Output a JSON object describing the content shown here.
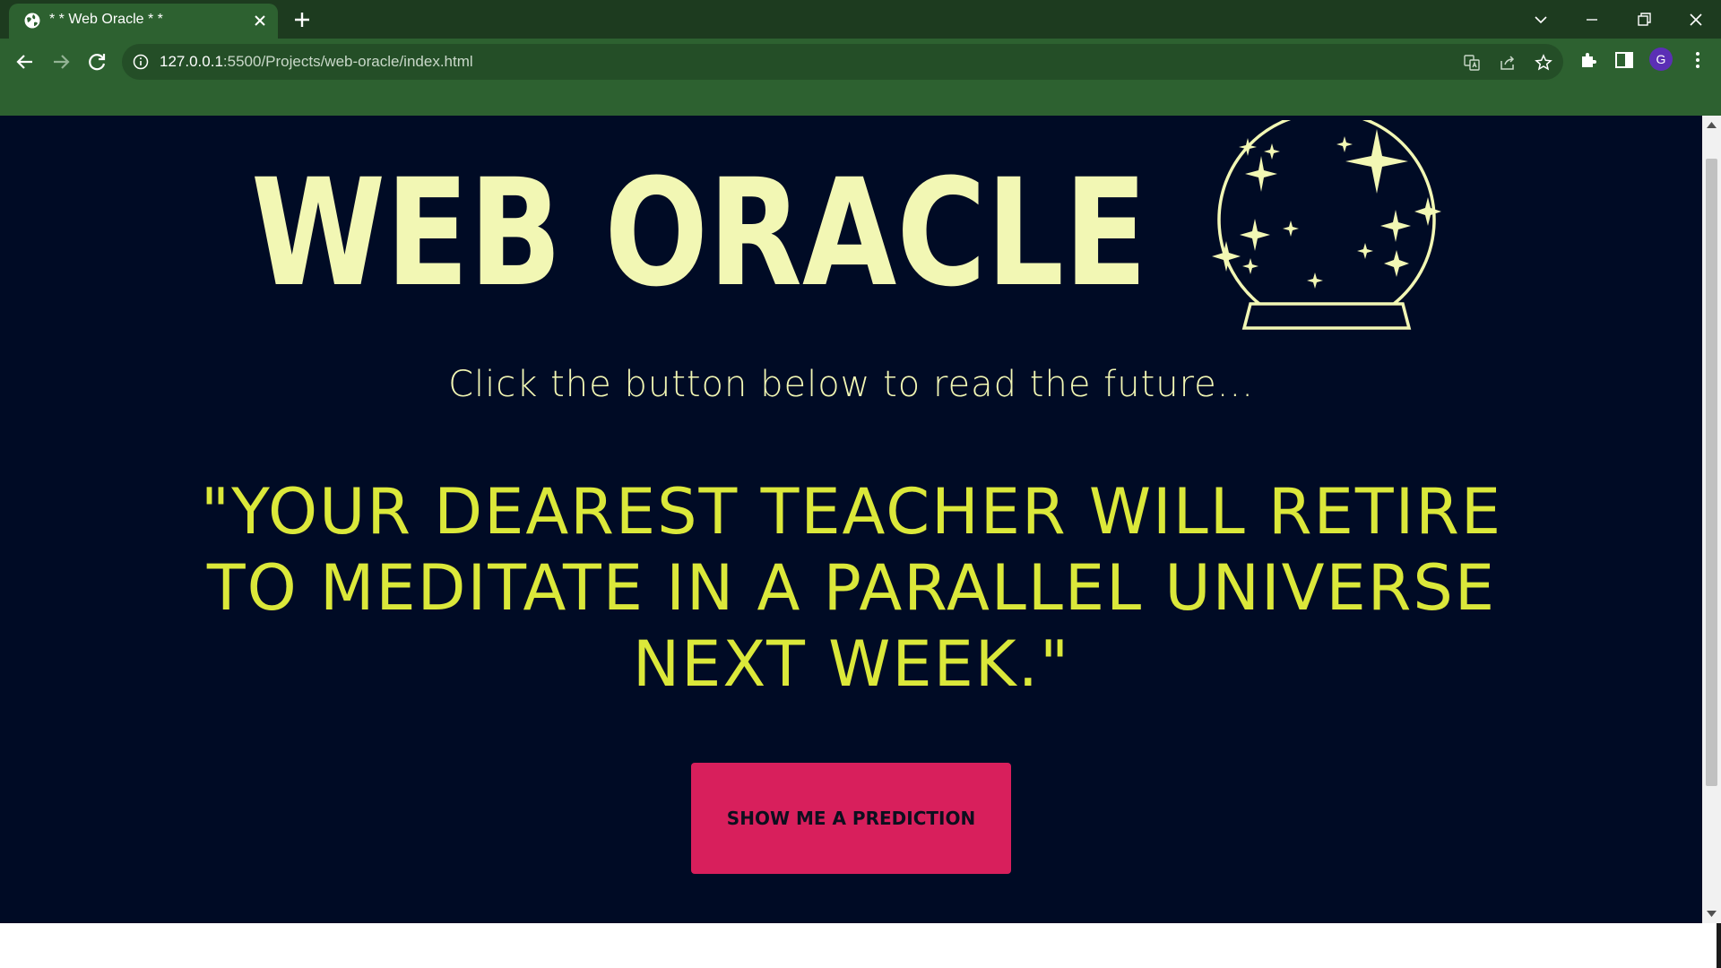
{
  "browser": {
    "tab_title": "* * Web Oracle * *",
    "url_host": "127.0.0.1",
    "url_rest": ":5500/Projects/web-oracle/index.html",
    "profile_initial": "G",
    "icons": [
      "globe-icon",
      "close-icon",
      "plus-icon",
      "chevron-down-icon",
      "minimize-icon",
      "restore-icon",
      "close-window-icon",
      "back-arrow-icon",
      "forward-arrow-icon",
      "reload-icon",
      "info-icon",
      "translate-icon",
      "share-icon",
      "star-icon",
      "puzzle-icon",
      "side-panel-icon",
      "kebab-menu-icon"
    ]
  },
  "page": {
    "title": "WEB ORACLE",
    "subtitle": "Click the button below to read the future...",
    "prediction": "\"YOUR DEAREST TEACHER WILL RETIRE TO MEDITATE IN A PARALLEL UNIVERSE NEXT WEEK.\"",
    "button_label": "SHOW ME A PREDICTION",
    "colors": {
      "background": "#000b25",
      "title": "#f2f7b4",
      "prediction": "#dbe83a",
      "button": "#d81f5c",
      "chrome": "#2d6130"
    }
  }
}
